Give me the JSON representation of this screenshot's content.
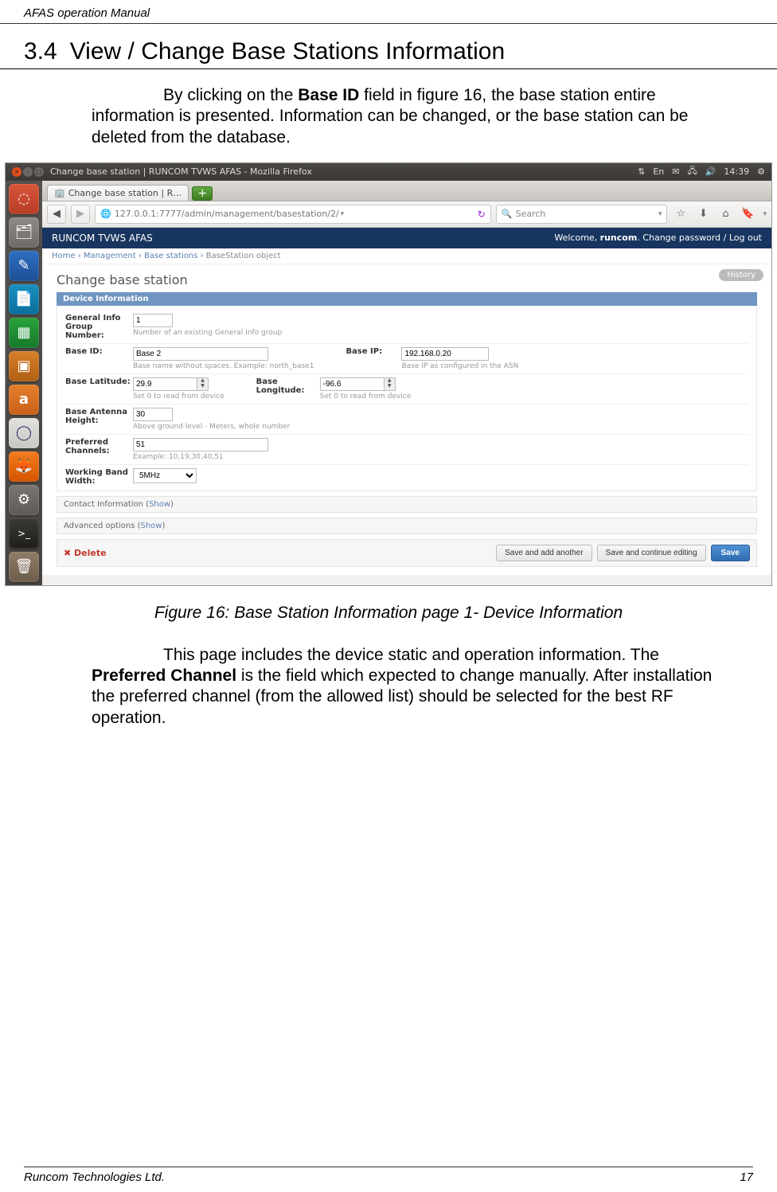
{
  "doc": {
    "header": "AFAS operation Manual",
    "footer_left": "Runcom Technologies Ltd.",
    "footer_right": "17",
    "section_num": "3.4",
    "section_title": "View / Change Base Stations Information",
    "para1_a": "By clicking on the ",
    "para1_b": "Base ID",
    "para1_c": " field in figure 16, the base station entire information is presented. Information can be changed, or the base station can be deleted from the database.",
    "caption": "Figure 16: Base Station Information page 1- Device Information",
    "para2_a": "This page includes the device static and operation information. The ",
    "para2_b": "Preferred Channel",
    "para2_c": " is the field which expected to change manually. After installation the preferred channel (from the allowed list) should be selected for the best RF operation."
  },
  "ubuntu": {
    "title": "Change base station | RUNCOM TVWS AFAS - Mozilla Firefox",
    "time": "14:39",
    "indicators": {
      "keyboard": "En",
      "mail": "✉",
      "net": "⇅",
      "sound": "🔊",
      "power": "⚙"
    },
    "launcher": {
      "dash": "◌",
      "files": "🗂",
      "blue": "✎",
      "writer": "📄",
      "calc": "▦",
      "impress": "▣",
      "amazon": "a",
      "eclipse": "◯",
      "firefox": "🦊",
      "gear": "⚙",
      "term": ">_",
      "trash": "🗑"
    }
  },
  "firefox": {
    "tab_title": "Change base station | R…",
    "url": "127.0.0.1:7777/admin/management/basestation/2/",
    "search_placeholder": "Search",
    "nav": {
      "back": "◀",
      "fwd": "▶",
      "globe": "🌐",
      "refresh": "↻",
      "dropdown": "▾",
      "mag": "🔍",
      "star": "☆",
      "dl": "⬇",
      "home": "⌂",
      "bm": "🔖"
    }
  },
  "admin": {
    "brand": "RUNCOM TVWS AFAS",
    "welcome_pre": "Welcome, ",
    "welcome_user": "runcom",
    "welcome_post": ". Change password / Log out",
    "breadcrumbs": {
      "a": "Home",
      "b": "Management",
      "c": "Base stations",
      "d": "BaseStation object"
    },
    "history": "History",
    "h1": "Change base station",
    "fs1_head": "Device Information",
    "fields": {
      "group_lbl": "General Info Group Number:",
      "group_val": "1",
      "group_help": "Number of an existing General Info group",
      "baseid_lbl": "Base ID:",
      "baseid_val": "Base 2",
      "baseid_help": "Base name without spaces. Example: north_base1",
      "baseip_lbl": "Base IP:",
      "baseip_val": "192.168.0.20",
      "baseip_help": "Base IP as configured in the ASN",
      "lat_lbl": "Base Latitude:",
      "lat_val": "29.9",
      "lat_help": "Set 0 to read from device",
      "lon_lbl": "Base Longitude:",
      "lon_val": "-96.6",
      "lon_help": "Set 0 to read from device",
      "ant_lbl": "Base Antenna Height:",
      "ant_val": "30",
      "ant_help": "Above ground level - Meters, whole number",
      "pref_lbl": "Preferred Channels:",
      "pref_val": "51",
      "pref_help": "Example: 10,19,30,40,51",
      "bw_lbl": "Working Band Width:",
      "bw_val": "5MHz"
    },
    "fs2": "Contact Information (",
    "fs2_show": "Show",
    "fs3": "Advanced options (",
    "fs3_show": "Show",
    "close_paren": ")",
    "delete": "✖ Delete",
    "save_add": "Save and add another",
    "save_cont": "Save and continue editing",
    "save": "Save"
  }
}
